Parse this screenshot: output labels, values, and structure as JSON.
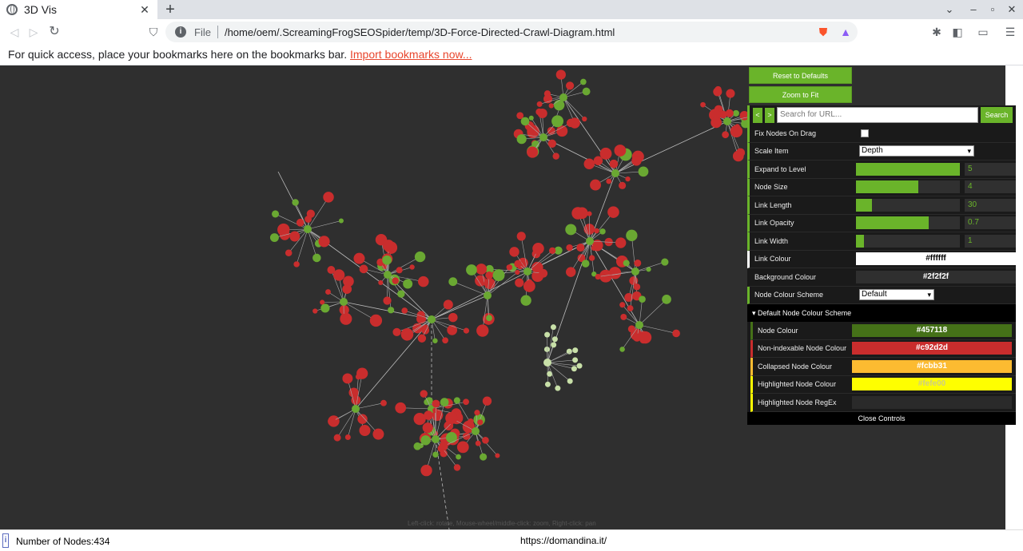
{
  "browser": {
    "tab_title": "3D Vis",
    "tab_close": "✕",
    "new_tab": "+",
    "scheme": "File",
    "url": "/home/oem/.ScreamingFrogSEOSpider/temp/3D-Force-Directed-Crawl-Diagram.html",
    "bookmarks_text": "For quick access, place your bookmarks here on the bookmarks bar.",
    "bookmarks_link": "Import bookmarks now..."
  },
  "controls": {
    "reset_label": "Reset to Defaults",
    "zoom_label": "Zoom to Fit",
    "prev_label": "<",
    "next_label": ">",
    "search_placeholder": "Search for URL...",
    "search_label": "Search",
    "fix_nodes_label": "Fix Nodes On Drag",
    "scale_item_label": "Scale Item",
    "scale_item_value": "Depth",
    "expand_label": "Expand to Level",
    "expand_value": "5",
    "expand_fraction": 1.0,
    "node_size_label": "Node Size",
    "node_size_value": "4",
    "node_size_fraction": 0.6,
    "link_length_label": "Link Length",
    "link_length_value": "30",
    "link_length_fraction": 0.15,
    "link_opacity_label": "Link Opacity",
    "link_opacity_value": "0.7",
    "link_opacity_fraction": 0.7,
    "link_width_label": "Link Width",
    "link_width_value": "1",
    "link_width_fraction": 0.08,
    "link_colour_label": "Link Colour",
    "link_colour_value": "#ffffff",
    "background_colour_label": "Background Colour",
    "background_colour_value": "#2f2f2f",
    "node_colour_scheme_label": "Node Colour Scheme",
    "node_colour_scheme_value": "Default",
    "section_title": "▾ Default Node Colour Scheme",
    "node_colour_label": "Node Colour",
    "node_colour_value": "#457118",
    "nonindexable_label": "Non-indexable Node Colour",
    "nonindexable_value": "#c92d2d",
    "collapsed_label": "Collapsed Node Colour",
    "collapsed_value": "#fcbb31",
    "highlighted_label": "Highlighted Node Colour",
    "highlighted_value": "#fefe00",
    "regex_label": "Highlighted Node RegEx",
    "close_label": "Close Controls"
  },
  "canvas": {
    "hint": "Left-click: rotate, Mouse-wheel/middle-click: zoom, Right-click: pan",
    "node_colors": {
      "indexable": "#6aa832",
      "nonindexable": "#c92d2d",
      "pale": "#c8e0a8"
    }
  },
  "status": {
    "nodes": "Number of Nodes:434",
    "url": "https://domandina.it/"
  }
}
